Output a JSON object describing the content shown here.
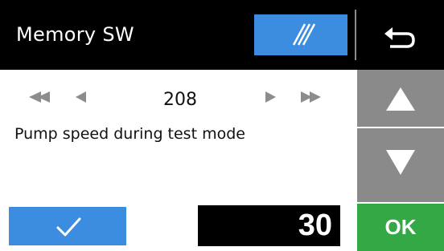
{
  "header": {
    "title": "Memory SW",
    "mode_icon": "diagonal-lines-icon",
    "back_icon": "return-arrow-icon"
  },
  "navigation": {
    "first_icon": "double-left-arrow-icon",
    "prev_icon": "left-arrow-icon",
    "next_icon": "right-arrow-icon",
    "last_icon": "double-right-arrow-icon",
    "number": "208"
  },
  "setting": {
    "description": "Pump speed during test mode",
    "value": "30"
  },
  "side_buttons": {
    "up_icon": "up-triangle-icon",
    "down_icon": "down-triangle-icon",
    "ok_label": "OK"
  },
  "footer": {
    "check_icon": "checkmark-icon"
  },
  "colors": {
    "header_bg": "#000000",
    "accent_blue": "#3c8ce0",
    "side_gray": "#8a8a8a",
    "ok_green": "#34a844",
    "arrow_gray": "#8c8c8c"
  }
}
